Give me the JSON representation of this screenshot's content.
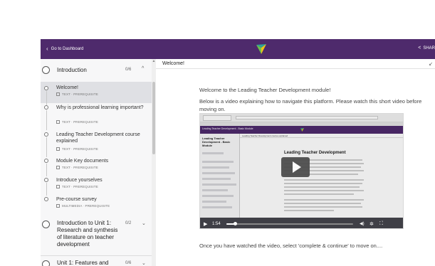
{
  "topbar": {
    "back_label": "Go to Dashboard",
    "back_icon": "chevron-left-icon",
    "share_label": "SHAR",
    "share_icon": "share-icon",
    "brand_color": "#4e2a6c"
  },
  "sidebar": {
    "sections": [
      {
        "title": "Introduction",
        "count": "0/6",
        "expanded": true
      },
      {
        "title": "Introduction to Unit 1: Research and synthesis of literature on teacher development",
        "count": "0/2",
        "expanded": false
      },
      {
        "title": "Unit 1: Features and",
        "count": "0/6",
        "expanded": false
      }
    ],
    "lessons": [
      {
        "title": "Welcome!",
        "meta": "TEXT · PREREQUISITE",
        "active": true
      },
      {
        "title": "Why is professional learning important?",
        "meta": "TEXT · PREREQUISITE",
        "active": false
      },
      {
        "title": "Leading Teacher Development course explained",
        "meta": "TEXT · PREREQUISITE",
        "active": false
      },
      {
        "title": "Module Key documents",
        "meta": "TEXT · PREREQUISITE",
        "active": false
      },
      {
        "title": "Introduce yourselves",
        "meta": "TEXT · PREREQUISITE",
        "active": false
      },
      {
        "title": "Pre-course survey",
        "meta": "MULTIMEDIA · PREREQUISITE",
        "active": false
      }
    ]
  },
  "content": {
    "header_title": "Welcome!",
    "intro_line_1": "Welcome to the Leading Teacher Development module!",
    "intro_line_2": "Below is a video explaining how to navigate this platform. Please watch this short video before moving on.",
    "outro": "Once you have watched the video, select 'complete & continue' to move on...."
  },
  "video": {
    "inner_page_title": "Leading Teacher Development",
    "inner_sidebar_title": "Leading Teacher Development - Basic Module",
    "inner_bar_label": "Leading Teacher Development - Basic Module",
    "inner_header_label": "Leading Teacher Development course explained",
    "time": "1:54",
    "progress_fraction": 0.07,
    "play_icon": "play-icon",
    "volume_icon": "volume-icon",
    "settings_icon": "gear-icon",
    "fullscreen_icon": "fullscreen-icon"
  }
}
